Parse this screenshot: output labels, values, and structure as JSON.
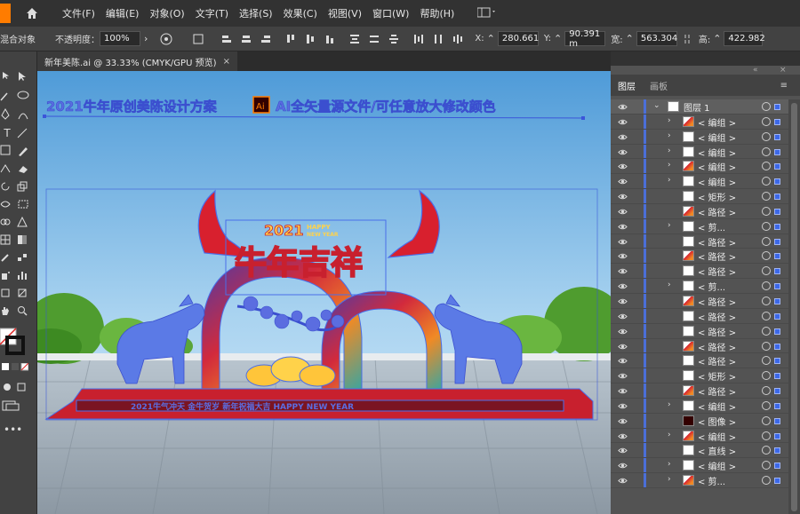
{
  "menubar": {
    "items": [
      "文件(F)",
      "编辑(E)",
      "对象(O)",
      "文字(T)",
      "选择(S)",
      "效果(C)",
      "视图(V)",
      "窗口(W)",
      "帮助(H)"
    ]
  },
  "control_bar": {
    "left_label": "混合对象",
    "opacity_label": "不透明度：",
    "opacity_value": "100%",
    "x_label": "X:",
    "x_value": "280.661",
    "y_label": "Y:",
    "y_value": "90.391 m",
    "w_label": "宽:",
    "w_value": "563.304",
    "h_label": "高:",
    "h_value": "422.982"
  },
  "document_tab": {
    "title": "新年美陈.ai @ 33.33% (CMYK/GPU 预览)"
  },
  "artwork": {
    "headline": "2021牛年原创美陈设计方案",
    "ai_badge": "Ai",
    "headline_right": "AI全矢量源文件/可任意放大修改颜色",
    "title_year": "2021",
    "title_happy": "HAPPY",
    "title_newyear": "NEW YEAR",
    "title_main": "牛年吉祥",
    "base_text": "2021牛气冲天 金牛贺岁   新年祝福大吉   HAPPY NEW YEAR"
  },
  "layers_panel": {
    "tabs": [
      "图层",
      "画板"
    ],
    "layers": [
      {
        "name": "图层 1",
        "arrow": "⌄",
        "top": true
      },
      {
        "name": "< 编组 >",
        "arrow": "›"
      },
      {
        "name": "< 编组 >",
        "arrow": "›"
      },
      {
        "name": "< 编组 >",
        "arrow": "›"
      },
      {
        "name": "< 编组 >",
        "arrow": "›"
      },
      {
        "name": "< 编组 >",
        "arrow": "›"
      },
      {
        "name": "< 矩形 >",
        "arrow": ""
      },
      {
        "name": "< 路径 >",
        "arrow": ""
      },
      {
        "name": "< 剪...",
        "arrow": "›"
      },
      {
        "name": "< 路径 >",
        "arrow": ""
      },
      {
        "name": "< 路径 >",
        "arrow": ""
      },
      {
        "name": "< 路径 >",
        "arrow": ""
      },
      {
        "name": "< 剪...",
        "arrow": "›"
      },
      {
        "name": "< 路径 >",
        "arrow": ""
      },
      {
        "name": "< 路径 >",
        "arrow": ""
      },
      {
        "name": "< 路径 >",
        "arrow": ""
      },
      {
        "name": "< 路径 >",
        "arrow": ""
      },
      {
        "name": "< 路径 >",
        "arrow": ""
      },
      {
        "name": "< 矩形 >",
        "arrow": ""
      },
      {
        "name": "< 路径 >",
        "arrow": ""
      },
      {
        "name": "< 编组 >",
        "arrow": "›"
      },
      {
        "name": "< 图像 >",
        "arrow": ""
      },
      {
        "name": "< 编组 >",
        "arrow": "›"
      },
      {
        "name": "< 直线 >",
        "arrow": ""
      },
      {
        "name": "< 编组 >",
        "arrow": "›"
      },
      {
        "name": "< 剪...",
        "arrow": "›"
      }
    ]
  },
  "colors": {
    "accent": "#ff7c00",
    "selection": "#3c68e8",
    "sky_top": "#5fa9e0",
    "arch_red": "#c8202e"
  }
}
